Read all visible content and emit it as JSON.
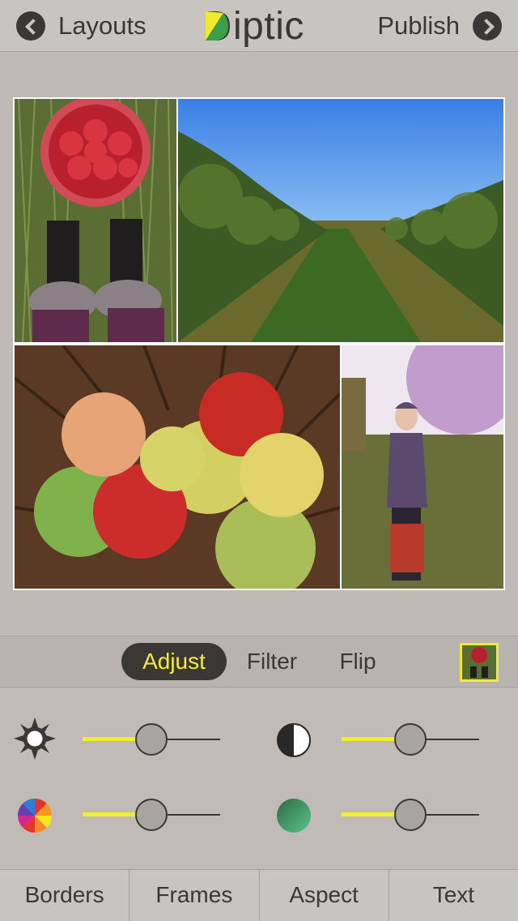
{
  "nav": {
    "back_label": "Layouts",
    "back_icon": "chevron-left-circle-icon",
    "forward_label": "Publish",
    "forward_icon": "chevron-right-circle-icon"
  },
  "logo": {
    "text": "iptic",
    "mark_colors": [
      "#f2ea2e",
      "#3aa04a",
      "#3a3735"
    ]
  },
  "collage": {
    "photos": [
      {
        "name": "apples-bucket-boots-photo"
      },
      {
        "name": "orchard-rows-photo"
      },
      {
        "name": "apples-in-barrel-photo"
      },
      {
        "name": "woman-with-bucket-photo"
      }
    ]
  },
  "tabs": {
    "items": [
      "Adjust",
      "Filter",
      "Flip"
    ],
    "active": "Adjust",
    "active_color": "#f4ec3a"
  },
  "adjustments": [
    {
      "icon": "brightness-sun-icon",
      "value": 0.5
    },
    {
      "icon": "contrast-half-circle-icon",
      "value": 0.5
    },
    {
      "icon": "saturation-color-wheel-icon",
      "value": 0.5
    },
    {
      "icon": "tint-green-circle-icon",
      "value": 0.5
    }
  ],
  "toolbar": {
    "items": [
      "Borders",
      "Frames",
      "Aspect",
      "Text"
    ]
  },
  "colors": {
    "accent": "#f5ee2d",
    "dark": "#3a3735",
    "background": "#bfbab5"
  }
}
